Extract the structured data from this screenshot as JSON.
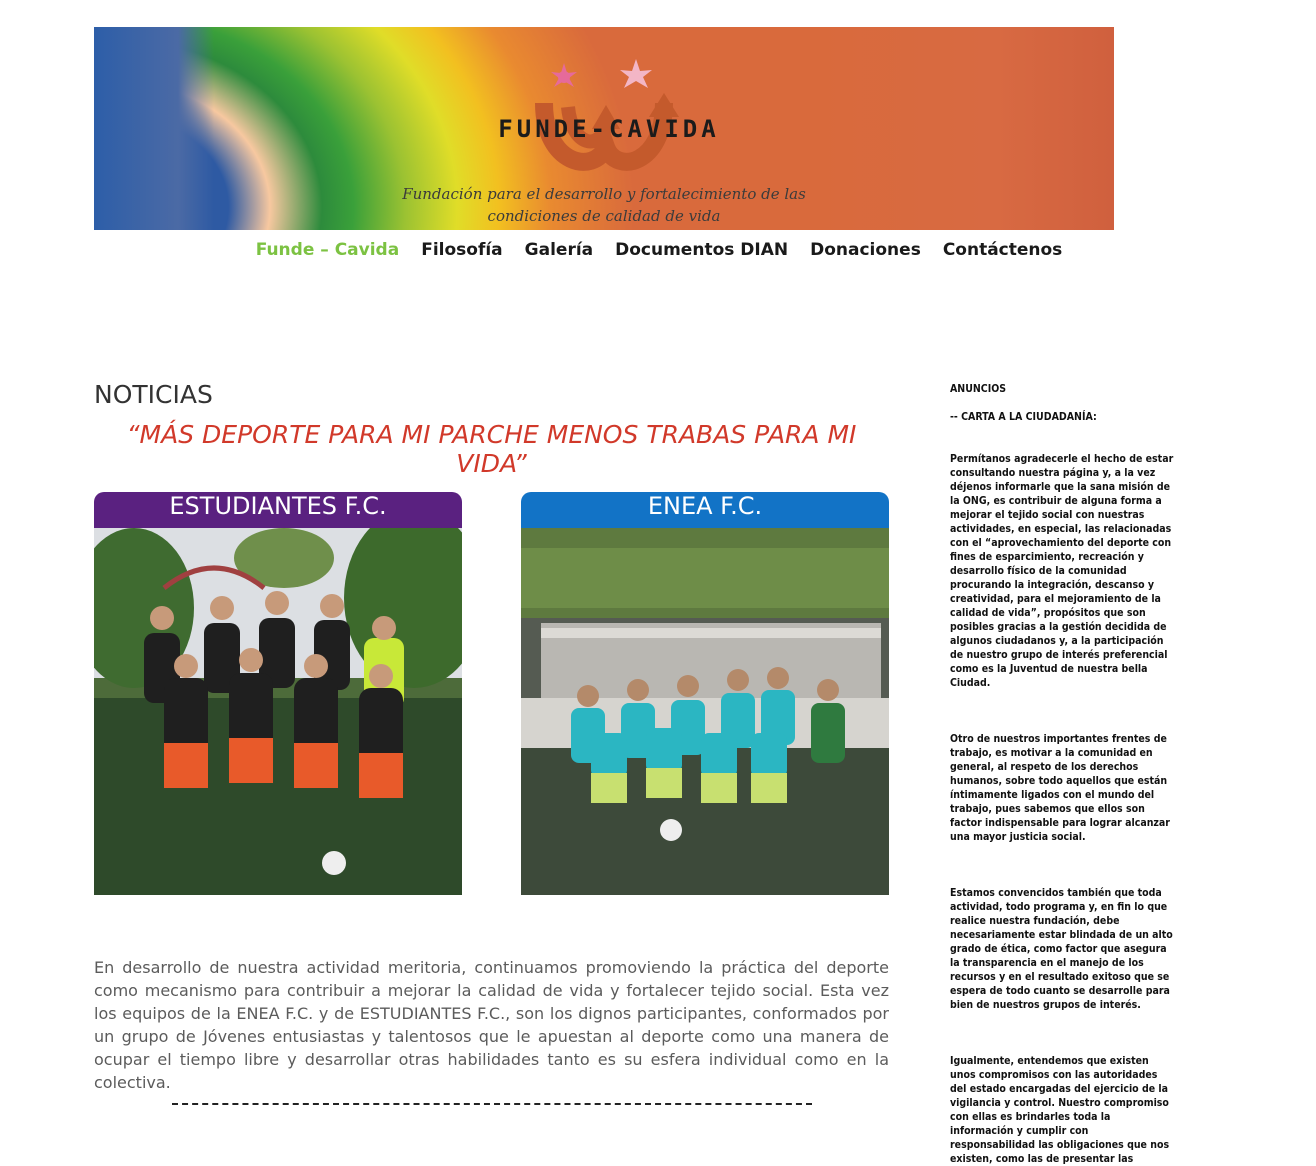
{
  "header": {
    "logo_text": "FUNDE-CAVIDA",
    "tagline_line1": "Fundación para el desarrollo y fortalecimiento de las",
    "tagline_line2": "condiciones de calidad de vida"
  },
  "nav": {
    "items": [
      {
        "label": "Funde – Cavida"
      },
      {
        "label": "Filosofía"
      },
      {
        "label": "Galería"
      },
      {
        "label": "Documentos DIAN"
      },
      {
        "label": "Donaciones"
      },
      {
        "label": "Contáctenos"
      }
    ]
  },
  "main": {
    "heading": "NOTICIAS",
    "headline": "“MÁS DEPORTE PARA MI PARCHE MENOS TRABAS PARA MI VIDA”",
    "teams": [
      {
        "name": "ESTUDIANTES F.C.",
        "color": "#5a2180"
      },
      {
        "name": "ENEA F.C.",
        "color": "#1273c6"
      }
    ],
    "body": "En desarrollo de nuestra actividad meritoria, continuamos promoviendo la práctica del deporte como mecanismo para contribuir a mejorar la calidad de vida y fortalecer tejido social. Esta vez los equipos de la ENEA F.C. y de ESTUDIANTES F.C., son los dignos participantes, conformados por un grupo de Jóvenes entusiastas y talentosos que le apuestan al deporte como una manera de ocupar el tiempo libre y desarrollar otras habilidades tanto es su esfera individual como en la colectiva.",
    "divider": "------------------------------------------------------------"
  },
  "sidebar": {
    "title": "ANUNCIOS",
    "subtitle": "-- CARTA A LA CIUDADANÍA:",
    "p1": "Permítanos agradecerle el hecho de estar consultando nuestra página y, a la vez déjenos informarle que la sana misión de la ONG, es contribuir de alguna forma a mejorar el tejido social con nuestras actividades, en especial, las relacionadas con el “aprovechamiento del deporte con fines de esparcimiento, recreación y desarrollo físico de la comunidad procurando la integración, descanso y creatividad, para el mejoramiento de la calidad de vida”, propósitos que son posibles gracias a la gestión decidida de algunos ciudadanos y, a la participación de nuestro grupo de interés preferencial como es la Juventud de nuestra bella Ciudad.",
    "p2": "Otro de nuestros importantes frentes de trabajo, es motivar a la comunidad en general, al respeto de los derechos humanos, sobre todo aquellos que están íntimamente ligados con el mundo del trabajo, pues sabemos que ellos son factor indispensable para lograr alcanzar una mayor justicia social.",
    "p3": "Estamos convencidos también que toda actividad, todo programa y, en fin lo que realice nuestra fundación, debe necesariamente estar blindada de un alto grado de ética, como factor que asegura la transparencia en el manejo de los recursos y en el resultado exitoso que se espera de todo cuanto se desarrolle para bien de nuestros grupos de interés.",
    "p4": "Igualmente, entendemos que existen unos compromisos con las autoridades del estado encargadas del ejercicio de la vigilancia y control. Nuestro compromiso con ellas es brindarles toda la información y cumplir con responsabilidad las obligaciones que nos existen, como las de presentar las"
  }
}
